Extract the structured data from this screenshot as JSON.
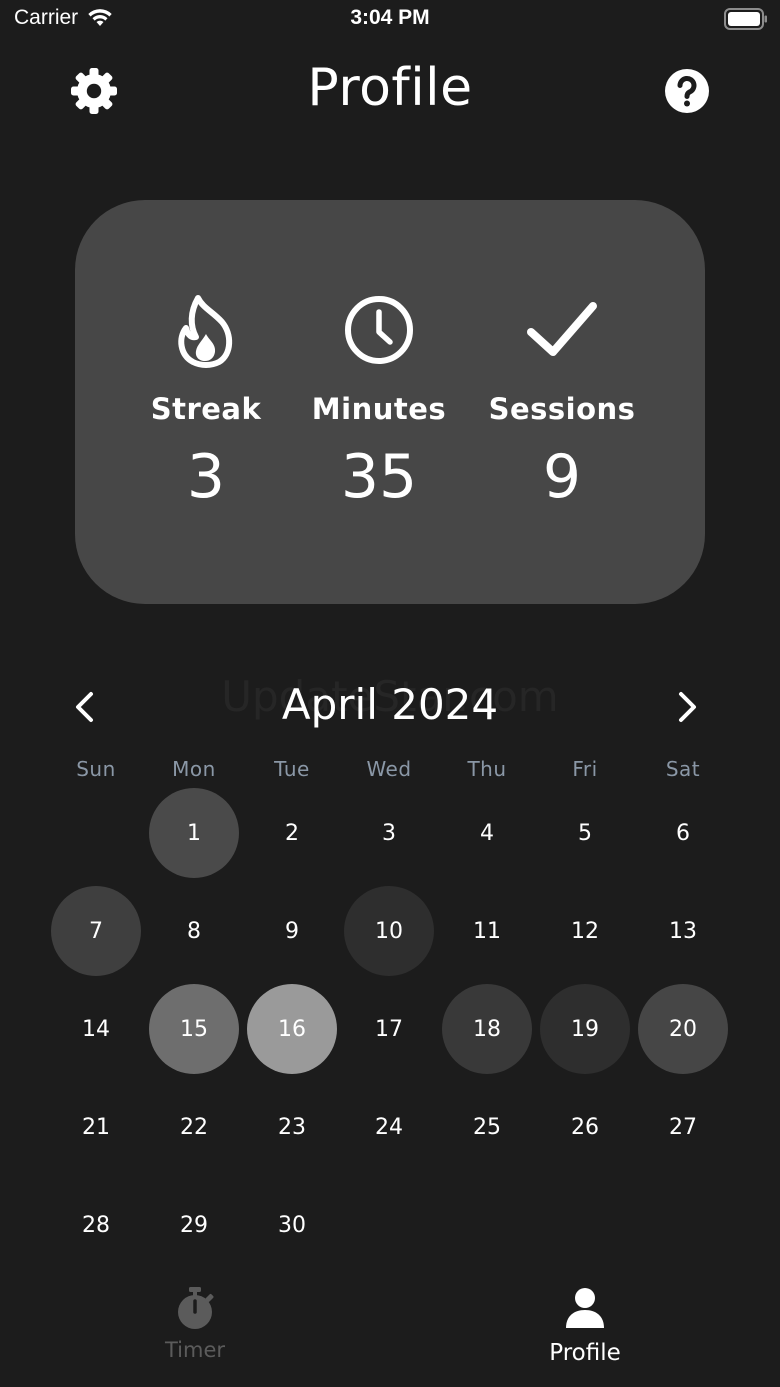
{
  "status_bar": {
    "carrier": "Carrier",
    "time": "3:04 PM"
  },
  "header": {
    "title": "Profile",
    "settings_icon": "gear-icon",
    "help_icon": "question-circle-icon"
  },
  "stats": [
    {
      "label": "Streak",
      "value": "3",
      "icon": "flame-icon"
    },
    {
      "label": "Minutes",
      "value": "35",
      "icon": "clock-icon"
    },
    {
      "label": "Sessions",
      "value": "9",
      "icon": "checkmark-icon"
    }
  ],
  "calendar": {
    "month": "April 2024",
    "watermark": "UpdateStar.com",
    "weekdays": [
      "Sun",
      "Mon",
      "Tue",
      "Wed",
      "Thu",
      "Fri",
      "Sat"
    ],
    "first_weekday_index": 1,
    "days_in_month": 30,
    "highlighted_days": [
      {
        "day": "1",
        "color": "#4a4a4a"
      },
      {
        "day": "7",
        "color": "#3f3f3f"
      },
      {
        "day": "10",
        "color": "#2e2e2e"
      },
      {
        "day": "15",
        "color": "#6e6e6e"
      },
      {
        "day": "16",
        "color": "#9a9a9a"
      },
      {
        "day": "18",
        "color": "#393939"
      },
      {
        "day": "19",
        "color": "#2e2e2e"
      },
      {
        "day": "20",
        "color": "#464646"
      }
    ]
  },
  "tab_bar": {
    "tabs": [
      {
        "label": "Timer",
        "icon": "stopwatch-icon",
        "active": false
      },
      {
        "label": "Profile",
        "icon": "person-icon",
        "active": true
      }
    ]
  },
  "colors": {
    "background": "#1c1c1c",
    "card": "#474747",
    "weekday_text": "#8a97a6",
    "inactive_tab": "#5b5b5b"
  }
}
